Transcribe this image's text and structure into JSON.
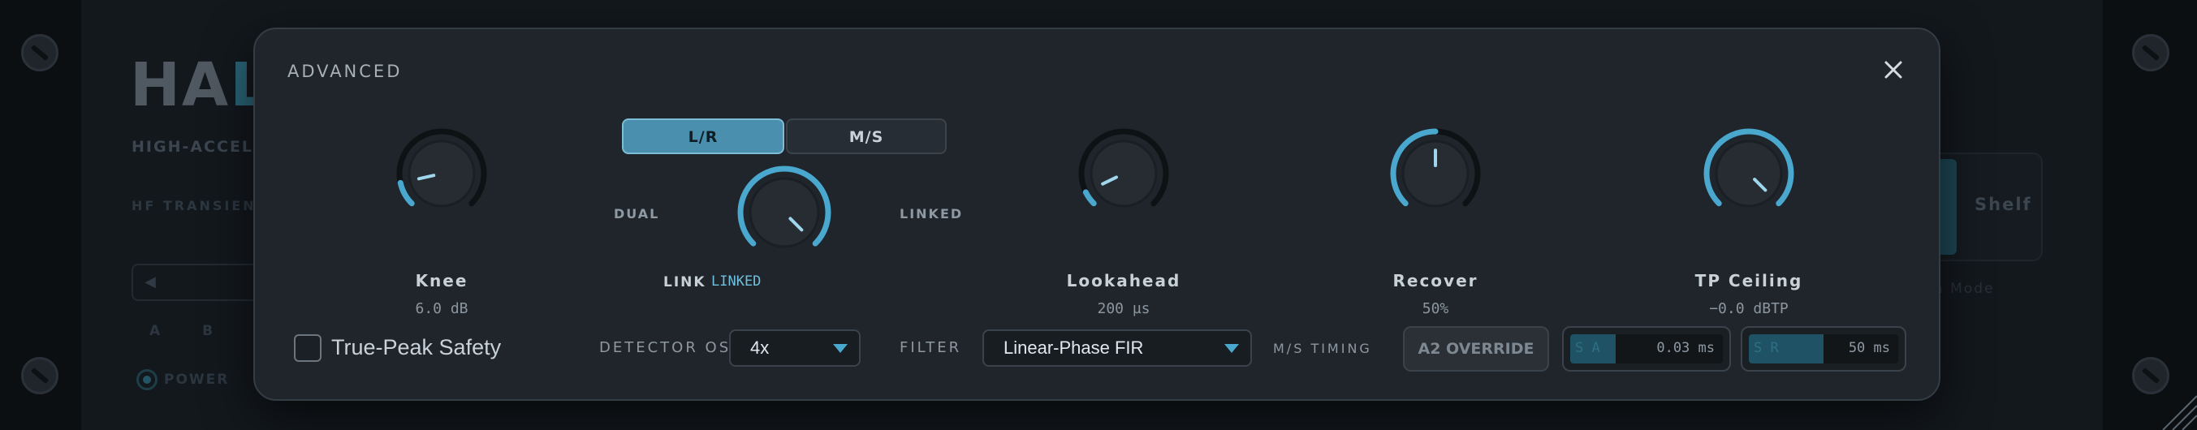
{
  "background": {
    "logo_prefix": "HA",
    "logo_accent": "L",
    "subtitle": "HIGH-ACCELI",
    "hf_label": "HF TRANSIENT",
    "ab_buttons": [
      "A",
      "B"
    ],
    "power_label": "POWER",
    "shelf_label": "Shelf",
    "mode_label": "n Mode"
  },
  "modal": {
    "title": "ADVANCED",
    "close_icon": "close-icon"
  },
  "knobs": {
    "knee": {
      "label": "Knee",
      "value": "6.0 dB",
      "level": 0.12
    },
    "link": {
      "label": "LINK",
      "value": "LINKED",
      "level": 1.0,
      "left_label": "DUAL",
      "right_label": "LINKED"
    },
    "lookahead": {
      "label": "Lookahead",
      "value": "200 µs",
      "level": 0.07
    },
    "recover": {
      "label": "Recover",
      "value": "50%",
      "level": 0.5
    },
    "tp_ceiling": {
      "label": "TP Ceiling",
      "value": "−0.0 dBTP",
      "level": 1.0
    }
  },
  "stereo_mode": {
    "options": [
      "L/R",
      "M/S"
    ],
    "selected": "L/R"
  },
  "bottom": {
    "true_peak_label": "True-Peak Safety",
    "true_peak_checked": false,
    "detector_os_label": "DETECTOR OS",
    "detector_os_value": "4x",
    "filter_label": "FILTER",
    "filter_value": "Linear-Phase FIR",
    "ms_timing_label": "M/S TIMING",
    "override_label": "A2 OVERRIDE",
    "meter_a": {
      "tag": "S A",
      "value": "0.03 ms",
      "fill": 0.3
    },
    "meter_b": {
      "tag": "S R",
      "value": "50 ms",
      "fill": 0.5
    }
  },
  "colors": {
    "accent": "#4aa8cf",
    "arc_track": "#0e1215",
    "knob_face": "#262c32",
    "selected_segment": "#4a8fae"
  }
}
